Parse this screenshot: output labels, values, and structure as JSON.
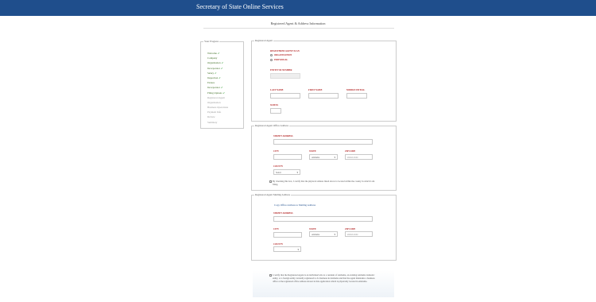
{
  "header": {
    "title": "Secretary of State Online Services"
  },
  "page": {
    "subtitle": "Registered Agent & Address Information"
  },
  "steps": {
    "legend": "Your Progress",
    "items": [
      {
        "label": "Welcome",
        "done": true
      },
      {
        "label": "Company",
        "done": false
      },
      {
        "label": "Organization",
        "done": true
      },
      {
        "label": "Incorporator",
        "done": true
      },
      {
        "label": "Salary",
        "done": true
      },
      {
        "label": "Inspection",
        "done": true
      },
      {
        "label": "Estates",
        "done": false
      },
      {
        "label": "Incorporator",
        "done": true
      },
      {
        "label": "Filing Options",
        "done": true
      },
      {
        "label": "Registered Agent",
        "pending": true
      },
      {
        "label": "Organization",
        "pending": true
      },
      {
        "label": "Business Operations",
        "pending": true
      },
      {
        "label": "Payment Info",
        "pending": true
      },
      {
        "label": "Review",
        "pending": true
      },
      {
        "label": "Summary",
        "pending": true
      }
    ]
  },
  "agent": {
    "legend": "Registered Agent",
    "type_label": "REGISTERED AGENT IS AN",
    "option_org": "ORGANIZATION",
    "option_ind": "INDIVIDUAL",
    "entity_label": "ENTITY ID NUMBER",
    "last_label": "LAST NAME",
    "first_label": "FIRST NAME",
    "middle_label": "MIDDLE INITIAL",
    "suffix_label": "SUFFIX"
  },
  "office": {
    "legend": "Registered Agent Office Address",
    "street_label": "STREET ADDRESS",
    "city_label": "CITY",
    "state_label": "STATE",
    "state_value": "Alabama",
    "zip_label": "ZIP CODE",
    "zip_placeholder": "#####-####",
    "county_label": "COUNTY",
    "county_value": "Select",
    "certify": "By checking this box, I certify that the physical address listed above is located within the county in which I am filing."
  },
  "mailing": {
    "legend": "Registered Agent Mailing Address",
    "copy_link": "Copy Office Address to Mailing Address",
    "street_label": "STREET ADDRESS",
    "city_label": "CITY",
    "state_label": "STATE",
    "state_value": "Alabama",
    "zip_label": "ZIP CODE",
    "zip_placeholder": "#####-####",
    "county_label": "COUNTY"
  },
  "footer_certify": "I certify that the Registered Agent is an individual who is a resident of Alabama, an existing Alabama domestic entity, or a foreign entity currently registered to do business in Alabama and that the agent maintains a business office at the registered office address shown in this application which is physically located in Alabama."
}
